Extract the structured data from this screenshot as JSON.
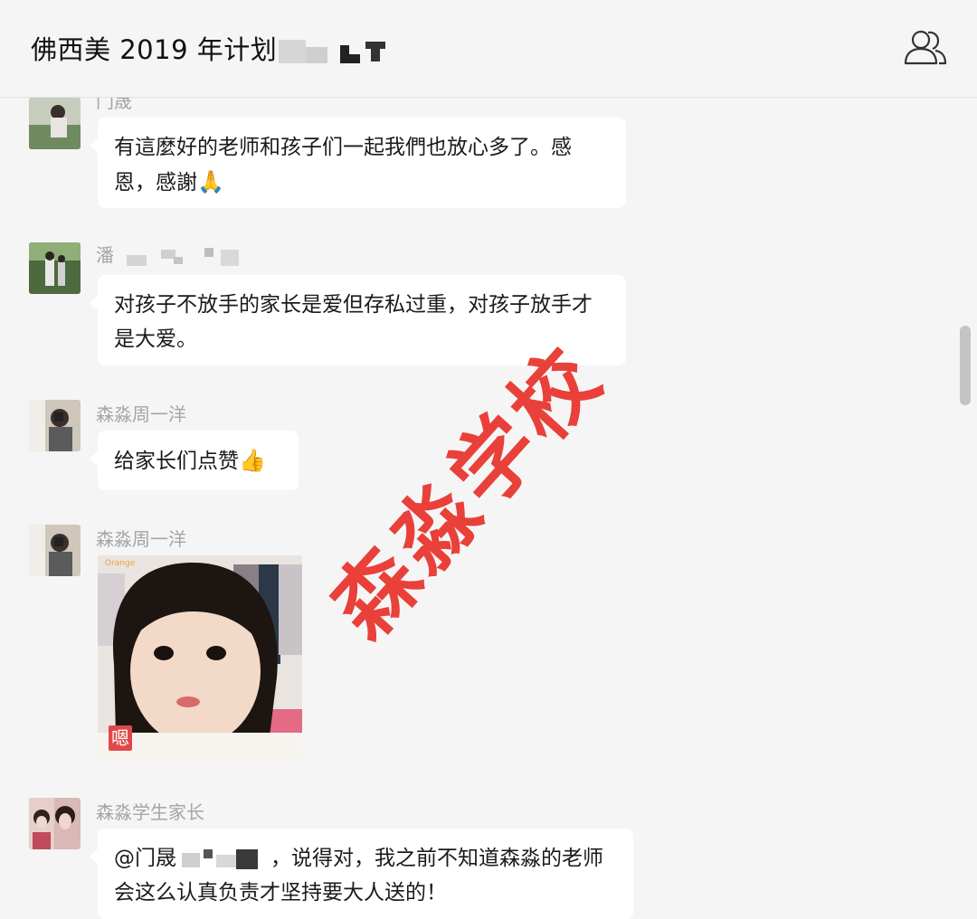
{
  "header": {
    "title": "佛西美 2019 年计划",
    "members_icon": "members-icon"
  },
  "messages": [
    {
      "sender": "门晟",
      "text": "有這麼好的老师和孩子们一起我們也放心多了。感恩，感謝",
      "emoji": "🙏"
    },
    {
      "sender": "潘",
      "text": "对孩子不放手的家长是爱但存私过重，对孩子放手才是大爱。"
    },
    {
      "sender": "森淼周一洋",
      "text": "给家长们点赞",
      "emoji": "👍"
    },
    {
      "sender": "森淼周一洋",
      "image_caption": "嗯",
      "image_brand": "Orange"
    },
    {
      "sender": "森淼学生家长",
      "mention": "@门晟",
      "text": "，说得对，我之前不知道森淼的老师会这么认真负责才坚持要大人送的！"
    }
  ],
  "watermark": "森淼学校",
  "colors": {
    "background": "#f5f5f5",
    "bubble": "#ffffff",
    "watermark": "#e8312b",
    "sender_name": "#a5a5a5"
  }
}
